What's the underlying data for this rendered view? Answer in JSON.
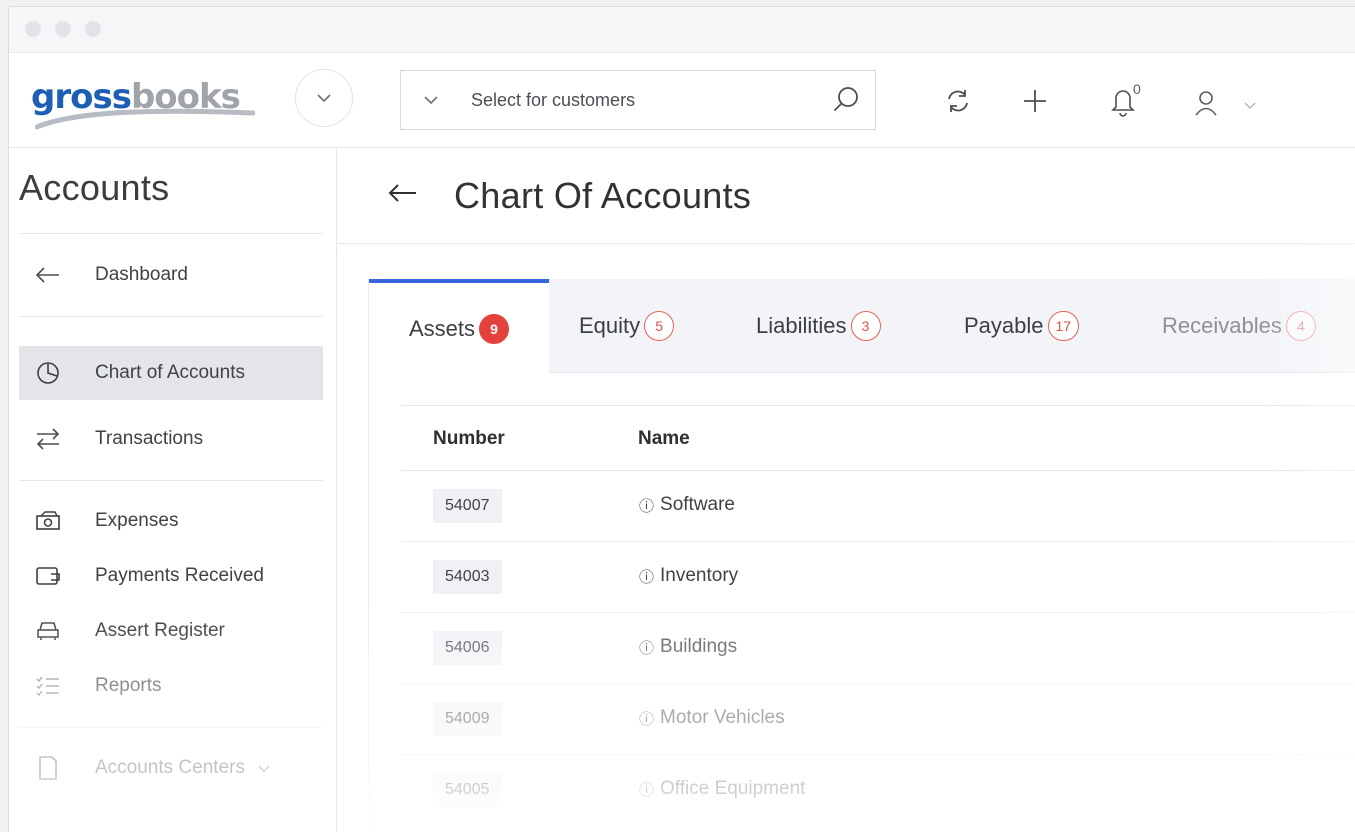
{
  "app": {
    "logo_primary": "gross",
    "logo_secondary": "books"
  },
  "header": {
    "search_placeholder": "Select for customers",
    "notification_count": "0"
  },
  "sidebar": {
    "title": "Accounts",
    "items": [
      {
        "label": "Dashboard",
        "icon": "arrow-left-icon"
      },
      {
        "label": "Chart of Accounts",
        "icon": "pie-chart-icon",
        "active": true
      },
      {
        "label": "Transactions",
        "icon": "transfer-icon"
      },
      {
        "label": "Expenses",
        "icon": "cash-icon"
      },
      {
        "label": "Payments Received",
        "icon": "wallet-icon"
      },
      {
        "label": "Assert Register",
        "icon": "car-icon"
      },
      {
        "label": "Reports",
        "icon": "checklist-icon"
      },
      {
        "label": "Accounts Centers",
        "icon": "document-icon"
      }
    ]
  },
  "main": {
    "title": "Chart Of Accounts",
    "tabs": [
      {
        "label": "Assets",
        "count": "9",
        "active": true
      },
      {
        "label": "Equity",
        "count": "5"
      },
      {
        "label": "Liabilities",
        "count": "3"
      },
      {
        "label": "Payable",
        "count": "17"
      },
      {
        "label": "Receivables",
        "count": "4"
      }
    ],
    "table": {
      "columns": [
        "Number",
        "Name"
      ],
      "rows": [
        {
          "number": "54007",
          "name": "Software"
        },
        {
          "number": "54003",
          "name": "Inventory"
        },
        {
          "number": "54006",
          "name": "Buildings"
        },
        {
          "number": "54009",
          "name": "Motor Vehicles"
        },
        {
          "number": "54005",
          "name": "Office Equipment"
        }
      ]
    }
  },
  "colors": {
    "brand_blue": "#1d5fb4",
    "tab_accent": "#3a63df",
    "badge_red": "#e3413b"
  }
}
